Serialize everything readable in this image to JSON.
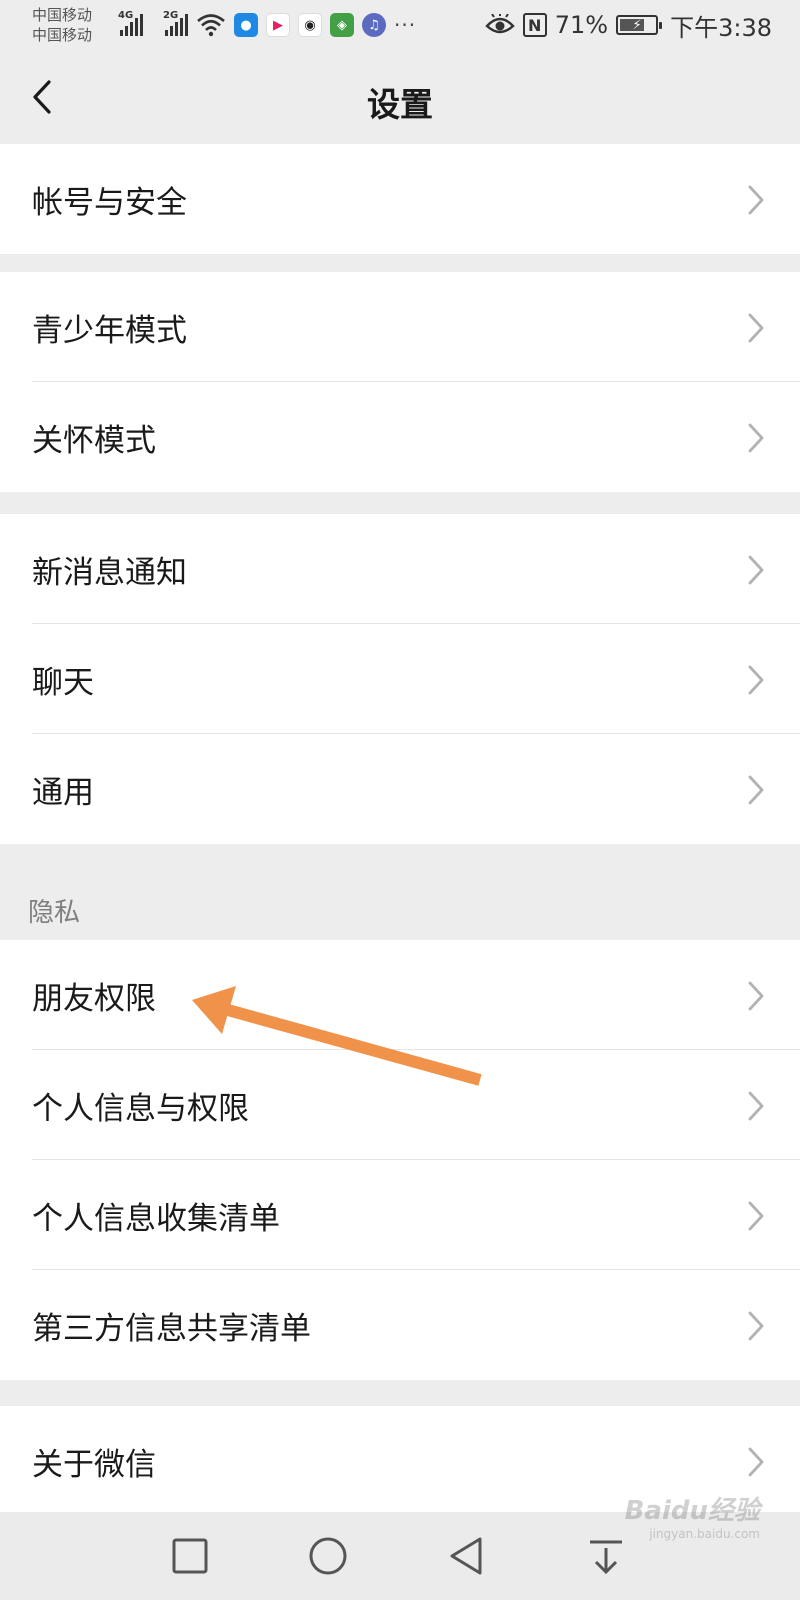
{
  "status_bar": {
    "carrier_1": "中国移动",
    "carrier_2": "中国移动",
    "net_1": "4G",
    "net_2": "2G",
    "battery": "71%",
    "battery_level": 0.71,
    "time": "下午3:38",
    "more": "···",
    "nfc": "N",
    "icons": [
      "signal-icon",
      "wifi-icon",
      "app-notification-icon",
      "eye-comfort-icon",
      "nfc-icon",
      "battery-icon"
    ]
  },
  "nav": {
    "title": "设置"
  },
  "groups": [
    {
      "items": [
        {
          "label": "帐号与安全"
        }
      ]
    },
    {
      "items": [
        {
          "label": "青少年模式"
        },
        {
          "label": "关怀模式"
        }
      ]
    },
    {
      "items": [
        {
          "label": "新消息通知"
        },
        {
          "label": "聊天"
        },
        {
          "label": "通用"
        }
      ]
    },
    {
      "header": "隐私",
      "items": [
        {
          "label": "朋友权限"
        },
        {
          "label": "个人信息与权限"
        },
        {
          "label": "个人信息收集清单"
        },
        {
          "label": "第三方信息共享清单"
        }
      ]
    },
    {
      "items": [
        {
          "label": "关于微信"
        }
      ]
    }
  ],
  "system_nav": [
    "recent-apps-icon",
    "home-icon",
    "back-icon",
    "download-icon"
  ],
  "watermark": {
    "text": "Baidu经验",
    "sub": "jingyan.baidu.com"
  },
  "colors": {
    "background": "#ededed",
    "annotation_arrow": "#f0924a",
    "card": "#ffffff"
  }
}
